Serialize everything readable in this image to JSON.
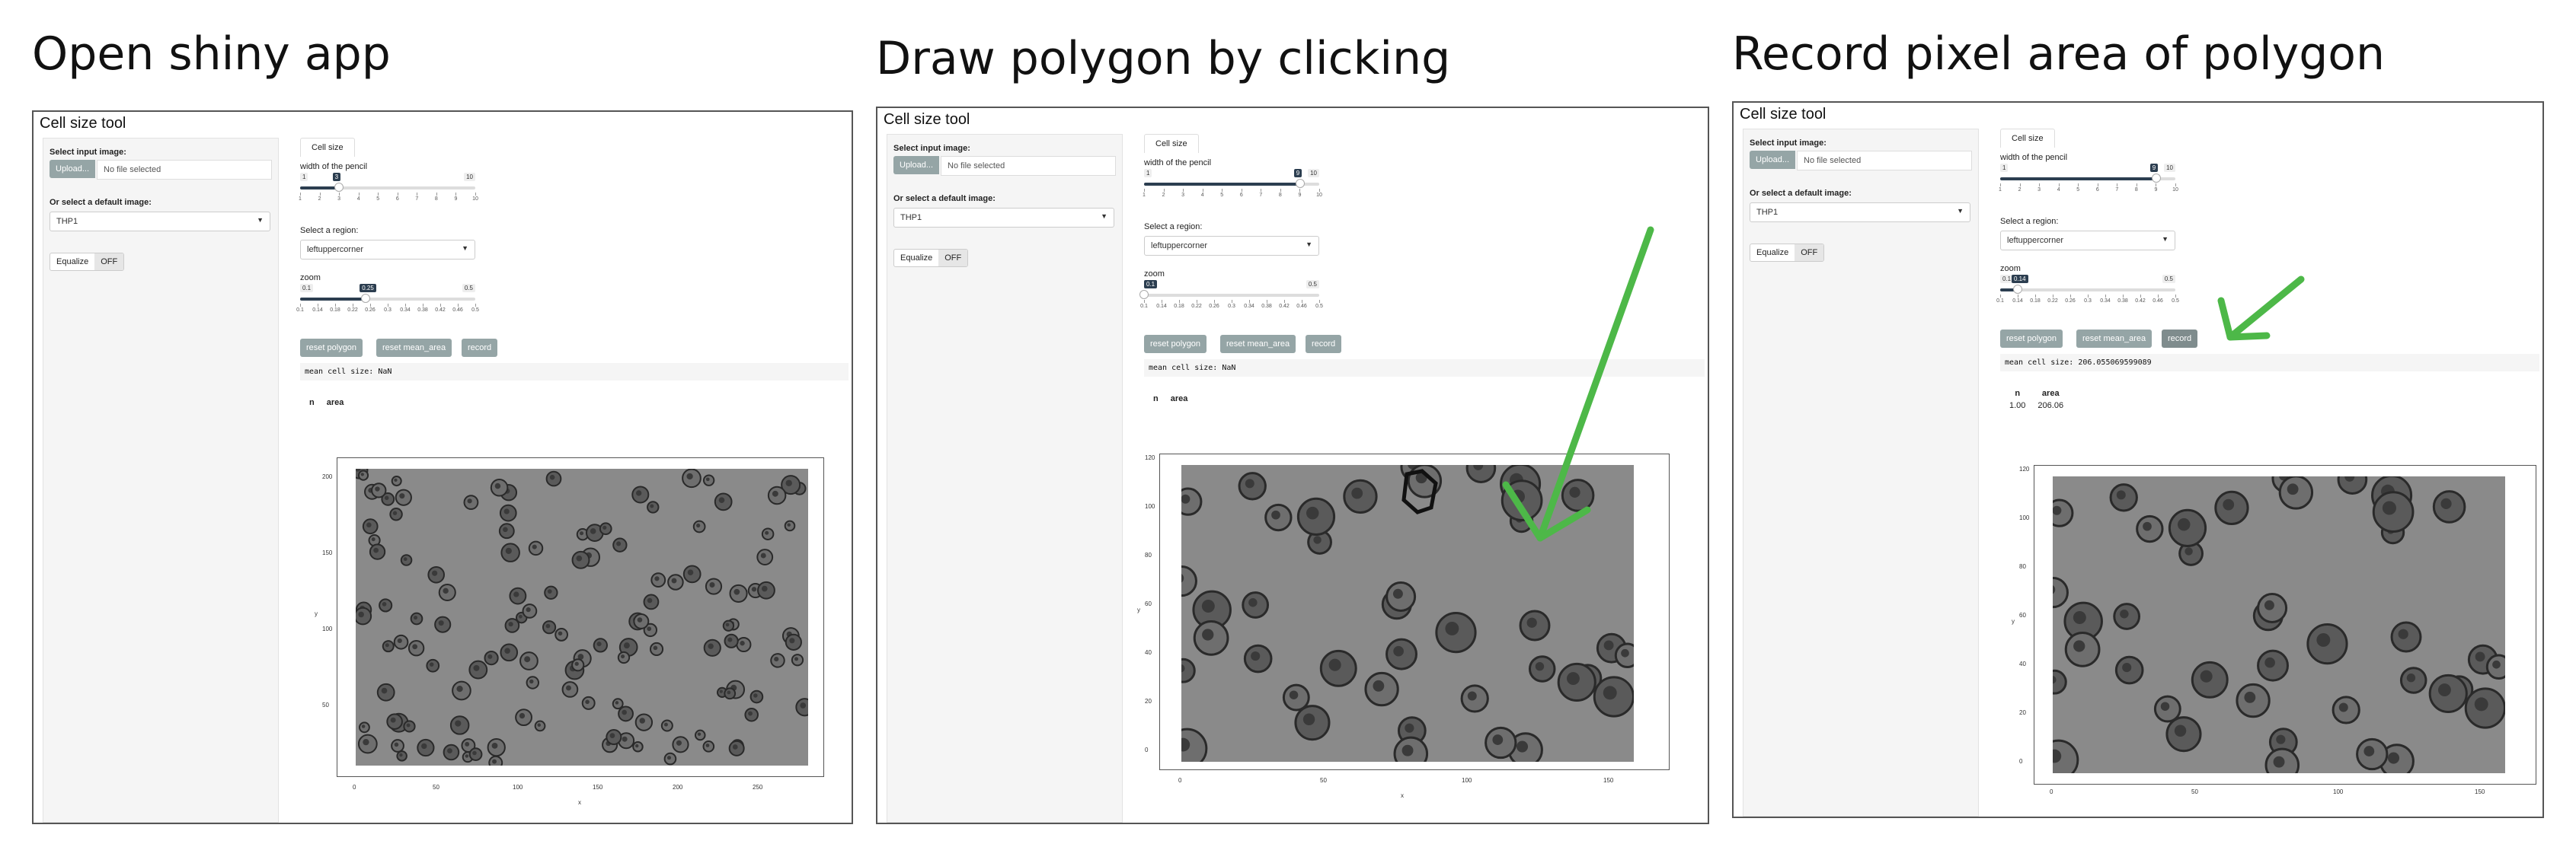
{
  "steps": [
    {
      "title": "Open shiny app",
      "app_title": "Cell size tool",
      "sidebar": {
        "input_label": "Select input image:",
        "upload_label": "Upload...",
        "file_text": "No file selected",
        "default_label": "Or select a default image:",
        "default_value": "THP1",
        "equalize_label": "Equalize",
        "equalize_state": "OFF"
      },
      "tab_label": "Cell size",
      "pencil": {
        "label": "width of the pencil",
        "min": "1",
        "max": "10",
        "value": "3",
        "fraction": 0.22,
        "ticks": [
          "1",
          "2",
          "3",
          "4",
          "5",
          "6",
          "7",
          "8",
          "9",
          "10"
        ]
      },
      "region": {
        "label": "Select a region:",
        "value": "leftuppercorner"
      },
      "zoom": {
        "label": "zoom",
        "min": "0.1",
        "max": "0.5",
        "value": "0.25",
        "fraction": 0.375,
        "ticks": [
          "0.1",
          "0.14",
          "0.18",
          "0.22",
          "0.26",
          "0.3",
          "0.34",
          "0.38",
          "0.42",
          "0.46",
          "0.5"
        ]
      },
      "buttons": {
        "reset_polygon": "reset polygon",
        "reset_mean": "reset mean_area",
        "record": "record"
      },
      "mean_output": "mean cell size: NaN",
      "table": {
        "headers": [
          "n",
          "area"
        ],
        "rows": []
      },
      "plot": {
        "x_ticks": [
          "0",
          "50",
          "100",
          "150",
          "200",
          "250"
        ],
        "y_ticks": [
          "200",
          "150",
          "100",
          "50"
        ],
        "xlab": "x",
        "ylab": "y"
      }
    },
    {
      "title": "Draw polygon by clicking",
      "app_title": "Cell size tool",
      "sidebar": {
        "input_label": "Select input image:",
        "upload_label": "Upload...",
        "file_text": "No file selected",
        "default_label": "Or select a default image:",
        "default_value": "THP1",
        "equalize_label": "Equalize",
        "equalize_state": "OFF"
      },
      "tab_label": "Cell size",
      "pencil": {
        "label": "width of the pencil",
        "min": "1",
        "max": "10",
        "value": "9",
        "fraction": 0.89,
        "ticks": [
          "1",
          "2",
          "3",
          "4",
          "5",
          "6",
          "7",
          "8",
          "9",
          "10"
        ]
      },
      "region": {
        "label": "Select a region:",
        "value": "leftuppercorner"
      },
      "zoom": {
        "label": "zoom",
        "min": "0.1",
        "max": "0.5",
        "value": "0.1",
        "fraction": 0.0,
        "ticks": [
          "0.1",
          "0.14",
          "0.18",
          "0.22",
          "0.26",
          "0.3",
          "0.34",
          "0.38",
          "0.42",
          "0.46",
          "0.5"
        ]
      },
      "buttons": {
        "reset_polygon": "reset polygon",
        "reset_mean": "reset mean_area",
        "record": "record"
      },
      "mean_output": "mean cell size: NaN",
      "table": {
        "headers": [
          "n",
          "area"
        ],
        "rows": []
      },
      "plot": {
        "x_ticks": [
          "0",
          "50",
          "100",
          "150"
        ],
        "y_ticks": [
          "120",
          "100",
          "80",
          "60",
          "40",
          "20",
          "0"
        ],
        "xlab": "x",
        "ylab": "y"
      }
    },
    {
      "title": "Record pixel area of polygon",
      "app_title": "Cell size tool",
      "sidebar": {
        "input_label": "Select input image:",
        "upload_label": "Upload...",
        "file_text": "No file selected",
        "default_label": "Or select a default image:",
        "default_value": "THP1",
        "equalize_label": "Equalize",
        "equalize_state": "OFF"
      },
      "tab_label": "Cell size",
      "pencil": {
        "label": "width of the pencil",
        "min": "1",
        "max": "10",
        "value": "9",
        "fraction": 0.89,
        "ticks": [
          "1",
          "2",
          "3",
          "4",
          "5",
          "6",
          "7",
          "8",
          "9",
          "10"
        ]
      },
      "region": {
        "label": "Select a region:",
        "value": "leftuppercorner"
      },
      "zoom": {
        "label": "zoom",
        "min": "0.1",
        "max": "0.5",
        "value": "0.14",
        "fraction": 0.1,
        "ticks": [
          "0.1",
          "0.14",
          "0.18",
          "0.22",
          "0.26",
          "0.3",
          "0.34",
          "0.38",
          "0.42",
          "0.46",
          "0.5"
        ]
      },
      "buttons": {
        "reset_polygon": "reset polygon",
        "reset_mean": "reset mean_area",
        "record": "record"
      },
      "mean_output": "mean cell size: 206.055069599089",
      "table": {
        "headers": [
          "n",
          "area"
        ],
        "rows": [
          [
            "1.00",
            "206.06"
          ]
        ]
      },
      "plot": {
        "x_ticks": [
          "0",
          "50",
          "100",
          "150"
        ],
        "y_ticks": [
          "120",
          "100",
          "80",
          "60",
          "40",
          "20",
          "0"
        ],
        "xlab": "x",
        "ylab": "y"
      }
    }
  ],
  "colors": {
    "arrow": "#4db848",
    "button": "#95a5a6",
    "slider": "#2c3e50"
  }
}
